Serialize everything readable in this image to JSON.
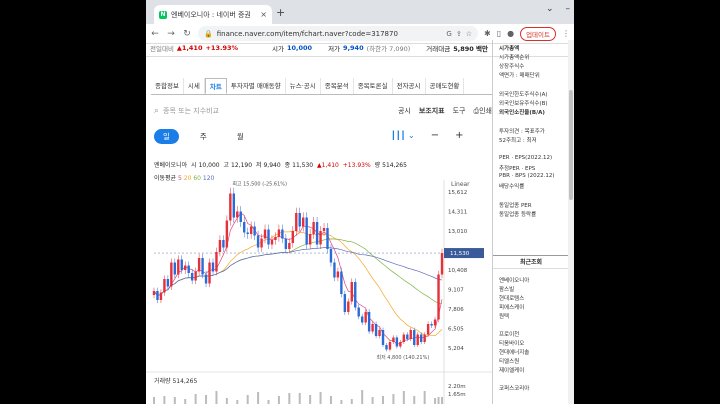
{
  "browser": {
    "tab_title": "엔베이오니아 : 네이버 증권",
    "favicon": "N",
    "new_tab": "+",
    "url": "finance.naver.com/item/fchart.naver?code=317870",
    "update_label": "업데이트"
  },
  "stock_header": {
    "prev_label": "전일대비",
    "change": "▲1,410",
    "change_pct": "+13.93%",
    "open_label": "시가",
    "open": "10,000",
    "low_label": "저가",
    "low": "9,940",
    "low_extra": "(하한가 7,090)",
    "amount_label": "거래대금",
    "amount": "5,890 백만"
  },
  "menu": [
    "종합정보",
    "시세",
    "차트",
    "투자자별 매매동향",
    "뉴스·공시",
    "종목분석",
    "종목토론실",
    "전자공시",
    "공매도현황"
  ],
  "search": {
    "placeholder": "종목 또는 지수비교",
    "options": [
      "공시",
      "보조지표",
      "도구",
      "인쇄"
    ]
  },
  "periods": [
    "일",
    "주",
    "월"
  ],
  "ohlc": {
    "name": "엔베이오니아",
    "o_label": "시",
    "o": "10,000",
    "h_label": "고",
    "h": "12,190",
    "l_label": "저",
    "l": "9,940",
    "c_label": "종",
    "c": "11,530",
    "chg": "▲1,410",
    "pct": "+13.93%",
    "v_label": "량",
    "v": "514,265"
  },
  "ma": {
    "label": "이동평균",
    "p1": "5",
    "p2": "20",
    "p3": "60",
    "p4": "120"
  },
  "chart_data": {
    "type": "line",
    "scale": "Linear",
    "y_ticks": [
      "15,612",
      "14,311",
      "13,010",
      "11,530",
      "10,408",
      "9,107",
      "7,806",
      "6,505",
      "5,204"
    ],
    "current_price": "11,530",
    "max_label": "최고 15,500 (-25.61%)",
    "min_label": "최저 4,800 (140.21%)",
    "volume_label": "거래량",
    "volume": "514,265",
    "volume_ticks": [
      "2.20m",
      "1.65m"
    ],
    "ylim": [
      4800,
      16000
    ],
    "series_close": [
      9000,
      8400,
      8900,
      9800,
      9300,
      10900,
      10100,
      11100,
      10400,
      10700,
      10200,
      9700,
      10300,
      11200,
      10100,
      9500,
      10900,
      10300,
      11600,
      12400,
      11900,
      13700,
      15500,
      13900,
      14300,
      13600,
      12900,
      12800,
      13300,
      12700,
      11900,
      12500,
      13100,
      12100,
      12400,
      12600,
      13100,
      12500,
      11800,
      12200,
      13000,
      14200,
      13300,
      13900,
      12100,
      12800,
      13600,
      12100,
      13000,
      13200,
      11800,
      10900,
      9900,
      10300,
      8800,
      7600,
      8300,
      9600,
      7900,
      7300,
      6900,
      7600,
      6300,
      6800,
      6000,
      6400,
      5400,
      5100,
      5600,
      5900,
      5300,
      5600,
      6100,
      5800,
      6400,
      5400,
      6100,
      5600,
      6100,
      6800,
      6700,
      7100,
      10100,
      11530
    ],
    "ma_colors": [
      "#e0457b",
      "#f5a623",
      "#7cb342",
      "#5c6bc0"
    ]
  },
  "right_panel": {
    "rows_top": [
      "시가총액",
      "시가총액순위",
      "상장주식수",
      "액면가 : 매매단위"
    ],
    "rows_foreign": [
      "외국인한도주식수(A)",
      "외국인보유주식수(B)",
      "외국인소진율(B/A)"
    ],
    "rows_invest": [
      "투자의견 : 목표주가",
      "52주최고 : 최저"
    ],
    "rows_per": [
      "PER · EPS(2022.12)",
      "추정PER · EPS",
      "PBR · BPS (2022.12)",
      "배당수익률"
    ],
    "rows_same": [
      "동일업종 PER",
      "동일업종 등락률"
    ],
    "recent_title": "최근조회",
    "recent_items": [
      "엔베이오니아",
      "팜스빌",
      "현대로템스",
      "피에스케이",
      "원텍",
      "",
      "프로이천",
      "티움바이오",
      "현대에너지솔",
      "티엘스원",
      "제이엘케이",
      "",
      "코퍼스코리아"
    ]
  }
}
